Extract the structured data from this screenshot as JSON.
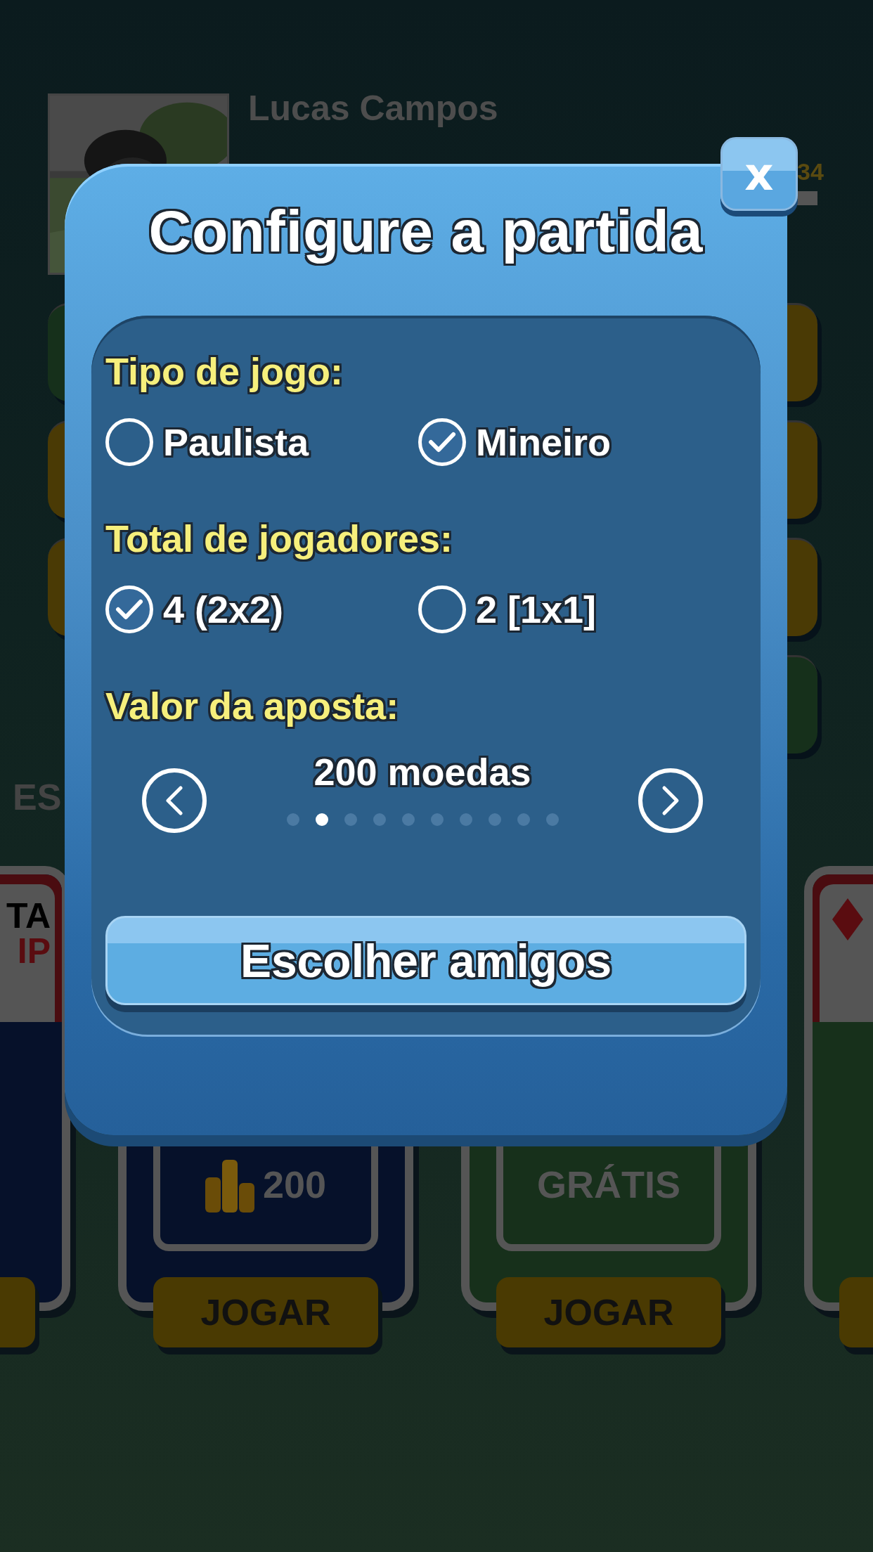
{
  "background": {
    "player": {
      "name": "Lucas Campos",
      "score": "34"
    },
    "left_buttons": [
      {
        "color": "#16301b"
      },
      {
        "color": "#4a3a05"
      },
      {
        "color": "#4a3a05"
      }
    ],
    "right_buttons": [
      {
        "color": "#4a3a05"
      },
      {
        "color": "#4a3a05"
      },
      {
        "color": "#4a3a05"
      },
      {
        "color": "#16301b"
      }
    ],
    "section_heading": "ES",
    "cards": [
      {
        "kind": "vip",
        "color": "#06112a",
        "lines": [
          "TA",
          "IP"
        ]
      },
      {
        "kind": "coins",
        "color": "#06112a",
        "price": "200",
        "button": "JOGAR"
      },
      {
        "kind": "free",
        "color": "#17301b",
        "price": "GRÁTIS",
        "button": "JOGAR"
      },
      {
        "kind": "diamond",
        "color": "#17301b"
      }
    ]
  },
  "dialog": {
    "title": "Configure a partida",
    "close": "x",
    "groups": [
      {
        "label": "Tipo de jogo:",
        "options": [
          {
            "label": "Paulista",
            "selected": false
          },
          {
            "label": "Mineiro",
            "selected": true
          }
        ]
      },
      {
        "label": "Total de jogadores:",
        "options": [
          {
            "label": "4 (2x2)",
            "selected": true
          },
          {
            "label": "2 [1x1]",
            "selected": false
          }
        ]
      }
    ],
    "bet": {
      "label": "Valor da aposta:",
      "value": "200 moedas",
      "pages": [
        {
          "selected": false
        },
        {
          "selected": true
        },
        {
          "selected": false
        },
        {
          "selected": false
        },
        {
          "selected": false
        },
        {
          "selected": false
        },
        {
          "selected": false
        },
        {
          "selected": false
        },
        {
          "selected": false
        },
        {
          "selected": false
        }
      ]
    },
    "button": "Escolher amigos"
  }
}
